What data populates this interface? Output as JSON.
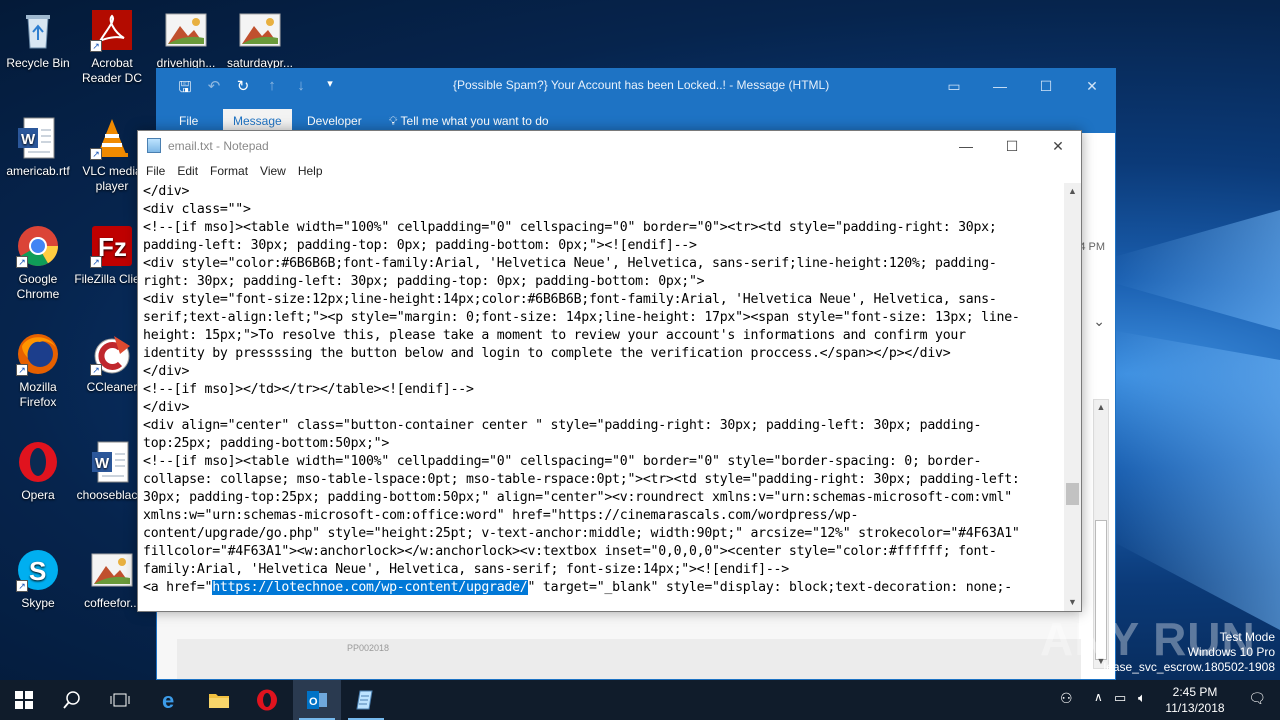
{
  "desktop": {
    "icons": [
      {
        "label": "Recycle Bin"
      },
      {
        "label": "Acrobat Reader DC"
      },
      {
        "label": "drivehigh..."
      },
      {
        "label": "saturdaypr..."
      },
      {
        "label": "americab.rtf"
      },
      {
        "label": "VLC media player"
      },
      {
        "label": "Google Chrome"
      },
      {
        "label": "FileZilla Client"
      },
      {
        "label": "Mozilla Firefox"
      },
      {
        "label": "CCleaner"
      },
      {
        "label": "Opera"
      },
      {
        "label": "chooseblac..."
      },
      {
        "label": "Skype"
      },
      {
        "label": "coffeefor..."
      }
    ]
  },
  "outlook": {
    "title": "{Possible Spam?} Your Account has been Locked..! - Message (HTML)",
    "tabs": [
      "File",
      "Message",
      "Developer"
    ],
    "tell_me": "Tell me what you want to do",
    "time_fragment": "4 PM",
    "footer_code": "PP002018"
  },
  "notepad": {
    "title": "email.txt - Notepad",
    "menu": [
      "File",
      "Edit",
      "Format",
      "View",
      "Help"
    ],
    "lines": [
      "</div>",
      "<div class=\"\">",
      "<!--[if mso]><table width=\"100%\" cellpadding=\"0\" cellspacing=\"0\" border=\"0\"><tr><td style=\"padding-right: 30px;",
      "padding-left: 30px; padding-top: 0px; padding-bottom: 0px;\"><![endif]-->",
      "<div style=\"color:#6B6B6B;font-family:Arial, 'Helvetica Neue', Helvetica, sans-serif;line-height:120%; padding-",
      "right: 30px; padding-left: 30px; padding-top: 0px; padding-bottom: 0px;\">",
      "<div style=\"font-size:12px;line-height:14px;color:#6B6B6B;font-family:Arial, 'Helvetica Neue', Helvetica, sans-",
      "serif;text-align:left;\"><p style=\"margin: 0;font-size: 14px;line-height: 17px\"><span style=\"font-size: 13px; line-",
      "height: 15px;\">To resolve this, please take a moment to review your account's informations and confirm your",
      "identity by pressssing the button below and login to complete the verification proccess.</span></p></div>",
      "</div>",
      "<!--[if mso]></td></tr></table><![endif]-->",
      "</div>",
      "<div align=\"center\" class=\"button-container center \" style=\"padding-right: 30px; padding-left: 30px; padding-",
      "top:25px; padding-bottom:50px;\">",
      "<!--[if mso]><table width=\"100%\" cellpadding=\"0\" cellspacing=\"0\" border=\"0\" style=\"border-spacing: 0; border-",
      "collapse: collapse; mso-table-lspace:0pt; mso-table-rspace:0pt;\"><tr><td style=\"padding-right: 30px; padding-left:",
      "30px; padding-top:25px; padding-bottom:50px;\" align=\"center\"><v:roundrect xmlns:v=\"urn:schemas-microsoft-com:vml\"",
      "xmlns:w=\"urn:schemas-microsoft-com:office:word\" href=\"https://cinemarascals.com/wordpress/wp-",
      "content/upgrade/go.php\" style=\"height:25pt; v-text-anchor:middle; width:90pt;\" arcsize=\"12%\" strokecolor=\"#4F63A1\"",
      "fillcolor=\"#4F63A1\"><w:anchorlock></w:anchorlock><v:textbox inset=\"0,0,0,0\"><center style=\"color:#ffffff; font-",
      "family:Arial, 'Helvetica Neue', Helvetica, sans-serif; font-size:14px;\"><![endif]-->"
    ],
    "last_line_pre": "<a href=\"",
    "last_line_selected": "https://lotechnoe.com/wp-content/upgrade/",
    "last_line_post": "\" target=\"_blank\" style=\"display: block;text-decoration: none;-"
  },
  "taskbar": {
    "time": "2:45 PM",
    "date": "11/13/2018"
  },
  "watermark": {
    "line1": "Test Mode",
    "line2": "Windows 10 Pro",
    "line3": "lease_svc_escrow.180502-1908",
    "brand": "ANY RUN"
  }
}
